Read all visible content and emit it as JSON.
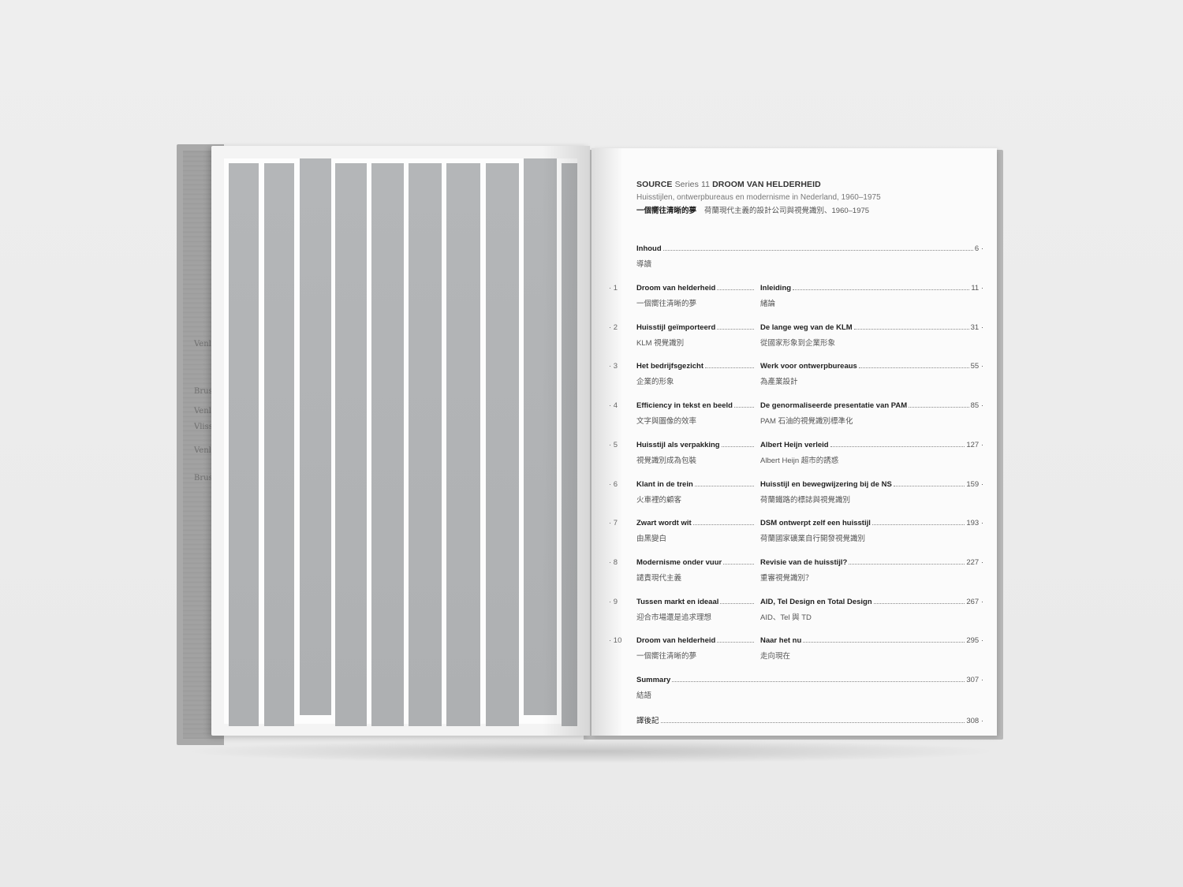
{
  "header": {
    "series_bold": "SOURCE",
    "series_light": "Series 11",
    "title": "DROOM VAN HELDERHEID",
    "subtitle_nl": "Huisstijlen, ontwerpbureaus en modernisme in Nederland, 1960–1975",
    "title_zh": "一個嚮往清晰的夢",
    "subtitle_zh": "荷蘭現代主義的設計公司與視覺識別、1960–1975"
  },
  "intro": {
    "title": "Inhoud",
    "page": "6 ·",
    "sub": "導讀"
  },
  "chapters": [
    {
      "num": "· 1",
      "left_title": "Droom van helderheid",
      "left_sub": "一個嚮往清晰的夢",
      "right_title": "Inleiding",
      "right_sub": "緒論",
      "page": "11 ·"
    },
    {
      "num": "· 2",
      "left_title": "Huisstijl geïmporteerd",
      "left_sub": "KLM 視覺識別",
      "right_title": "De lange weg van de KLM",
      "right_sub": "從國家形象到企業形象",
      "page": "31 ·"
    },
    {
      "num": "· 3",
      "left_title": "Het bedrijfsgezicht",
      "left_sub": "企業的形象",
      "right_title": "Werk voor ontwerpbureaus",
      "right_sub": "為產業設計",
      "page": "55 ·"
    },
    {
      "num": "· 4",
      "left_title": "Efficiency in tekst en beeld",
      "left_sub": "文字與圖像的效率",
      "right_title": "De genormaliseerde presentatie van PAM",
      "right_sub": "PAM 石油的視覺識別標準化",
      "page": "85 ·"
    },
    {
      "num": "· 5",
      "left_title": "Huisstijl als verpakking",
      "left_sub": "視覺識別成為包裝",
      "right_title": "Albert Heijn verleid",
      "right_sub": "Albert Heijn 超市的誘惑",
      "page": "127 ·"
    },
    {
      "num": "· 6",
      "left_title": "Klant in de trein",
      "left_sub": "火車裡的顧客",
      "right_title": "Huisstijl en bewegwijzering bij de NS",
      "right_sub": "荷蘭鐵路的標誌與視覺識別",
      "page": "159 ·"
    },
    {
      "num": "· 7",
      "left_title": "Zwart wordt wit",
      "left_sub": "由黑變白",
      "right_title": "DSM ontwerpt zelf een huisstijl",
      "right_sub": "荷蘭國家礦業自行開發視覺識別",
      "page": "193 ·"
    },
    {
      "num": "· 8",
      "left_title": "Modernisme onder vuur",
      "left_sub": "譴責現代主義",
      "right_title": "Revisie van de huisstijl?",
      "right_sub": "重審視覺識別？",
      "page": "227 ·"
    },
    {
      "num": "· 9",
      "left_title": "Tussen markt en ideaal",
      "left_sub": "迎合市場還是追求理想",
      "right_title": "AID, Tel Design en Total Design",
      "right_sub": "AID、Tel 與 TD",
      "page": "267 ·"
    },
    {
      "num": "· 10",
      "left_title": "Droom van helderheid",
      "left_sub": "一個嚮往清晰的夢",
      "right_title": "Naar het nu",
      "right_sub": "走向現在",
      "page": "295 ·"
    }
  ],
  "summary": {
    "title": "Summary",
    "page": "307 ·",
    "sub": "結語"
  },
  "afterword": {
    "title": "譯後記",
    "page": "308 ·"
  },
  "endpaper_marks": [
    "Venlo",
    "Brus",
    "Venlo",
    "Vlissin",
    "Venlo",
    "Brus"
  ],
  "colors": {
    "stripe": "#b2b4b6",
    "page": "#fbfbfb",
    "cloth": "#a9a9a9"
  }
}
